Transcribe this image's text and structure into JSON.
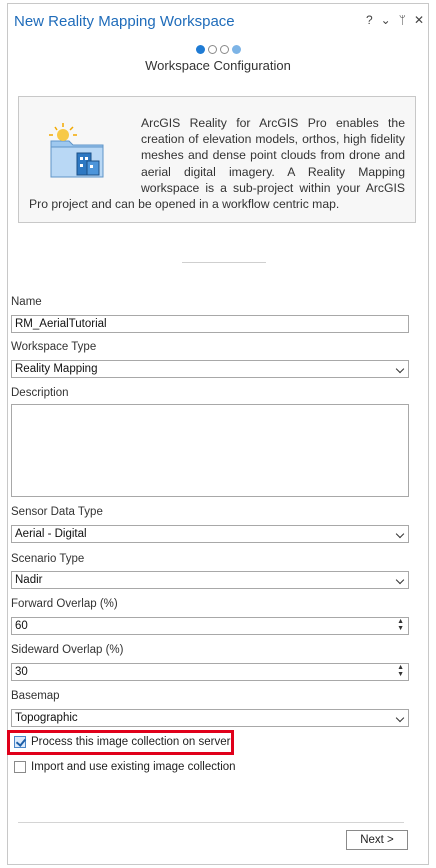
{
  "window": {
    "title": "New Reality Mapping Workspace",
    "controls": {
      "help": "?",
      "menu": "⌄",
      "pin": "𝟰",
      "close": "✕"
    }
  },
  "wizard": {
    "step_label": "Workspace Configuration",
    "steps": [
      "active",
      "empty",
      "empty",
      "light"
    ]
  },
  "info": {
    "text": "ArcGIS Reality for ArcGIS Pro enables the creation of elevation models, orthos, high fidelity meshes and dense point clouds from drone and aerial digital imagery. A Reality Mapping workspace is a sub-project within your ArcGIS Pro project and can be opened in a workflow centric map."
  },
  "form": {
    "name_label": "Name",
    "name_value": "RM_AerialTutorial",
    "workspace_type_label": "Workspace Type",
    "workspace_type_value": "Reality Mapping",
    "description_label": "Description",
    "description_value": "",
    "sensor_label": "Sensor Data Type",
    "sensor_value": "Aerial - Digital",
    "scenario_label": "Scenario Type",
    "scenario_value": "Nadir",
    "forward_label": "Forward Overlap (%)",
    "forward_value": "60",
    "sideward_label": "Sideward Overlap (%)",
    "sideward_value": "30",
    "basemap_label": "Basemap",
    "basemap_value": "Topographic",
    "process_server_label": "Process this image collection on server",
    "process_server_checked": true,
    "import_existing_label": "Import and use existing image collection",
    "import_existing_checked": false
  },
  "footer": {
    "next_label": "Next >"
  },
  "colors": {
    "accent": "#1f6cba",
    "highlight": "#e0001a"
  }
}
